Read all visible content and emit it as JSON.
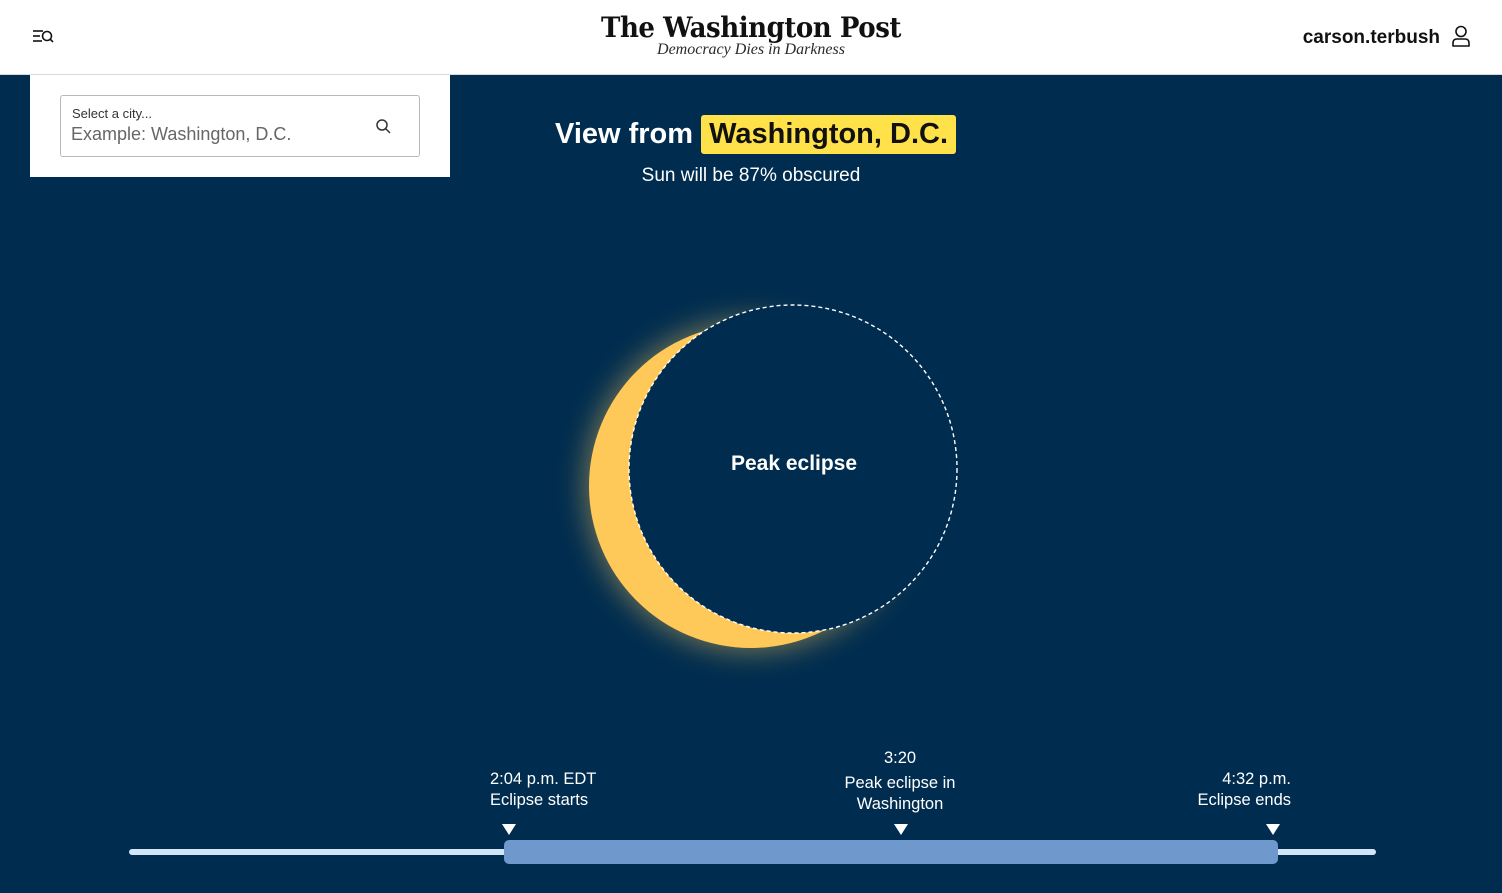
{
  "header": {
    "logo": "The Washington Post",
    "tagline": "Democracy Dies in Darkness",
    "username": "carson.terbush",
    "menu_icon": "menu-search-icon",
    "user_icon": "user-icon"
  },
  "search": {
    "label": "Select a city...",
    "placeholder": "Example: Washington, D.C.",
    "value": "",
    "icon": "search-icon"
  },
  "headline": {
    "prefix": "View from",
    "city": "Washington, D.C."
  },
  "subtitle": "Sun will be 87% obscured",
  "eclipse": {
    "label": "Peak eclipse",
    "obscured_percent": 87,
    "sun_color": "#ffc95a",
    "moon_outline_color": "#ffffff"
  },
  "timeline": {
    "start": {
      "time": "2:04 p.m. EDT",
      "label": "Eclipse starts"
    },
    "peak": {
      "time": "3:20",
      "label_line1": "Peak eclipse in",
      "label_line2": "Washington"
    },
    "end": {
      "time": "4:32 p.m.",
      "label": "Eclipse ends"
    },
    "track_color": "#d3e6f7",
    "range_color": "#6f99cc"
  },
  "colors": {
    "background": "#002d4f",
    "highlight": "#ffe24a"
  }
}
